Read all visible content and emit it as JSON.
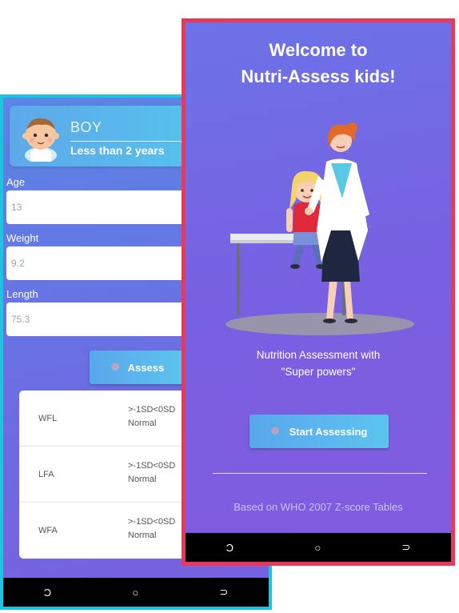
{
  "back_screen": {
    "profile": {
      "gender": "BOY",
      "age_group": "Less than 2 years",
      "avatar_icon": "baby-avatar-icon"
    },
    "fields": {
      "age": {
        "label": "Age",
        "value": "13"
      },
      "weight": {
        "label": "Weight",
        "value": "9.2"
      },
      "length": {
        "label": "Length",
        "value": "75.3"
      }
    },
    "assess_button": {
      "label": "Assess",
      "icon": "gear-icon"
    },
    "results": [
      {
        "code": "WFL",
        "range": ">-1SD<0SD",
        "status": "Normal"
      },
      {
        "code": "LFA",
        "range": ">-1SD<0SD",
        "status": "Normal"
      },
      {
        "code": "WFA",
        "range": ">-1SD<0SD",
        "status": "Normal"
      }
    ],
    "border_color": "#1ec3e0"
  },
  "front_screen": {
    "title_line1": "Welcome to",
    "title_line2": "Nutri-Assess kids!",
    "description_line1": "Nutrition Assessment with",
    "description_line2": "\"Super powers\"",
    "start_button": {
      "label": "Start Assessing",
      "icon": "gear-icon"
    },
    "footer": "Based on WHO 2007 Z-score Tables",
    "illustration": "nurse-with-child-illustration",
    "border_color": "#e8395b"
  },
  "nav": {
    "back_glyph": "Ɔ",
    "home_glyph": "○",
    "recents_glyph": "⊃",
    "icons": [
      "recents-icon",
      "home-icon",
      "back-icon"
    ]
  }
}
